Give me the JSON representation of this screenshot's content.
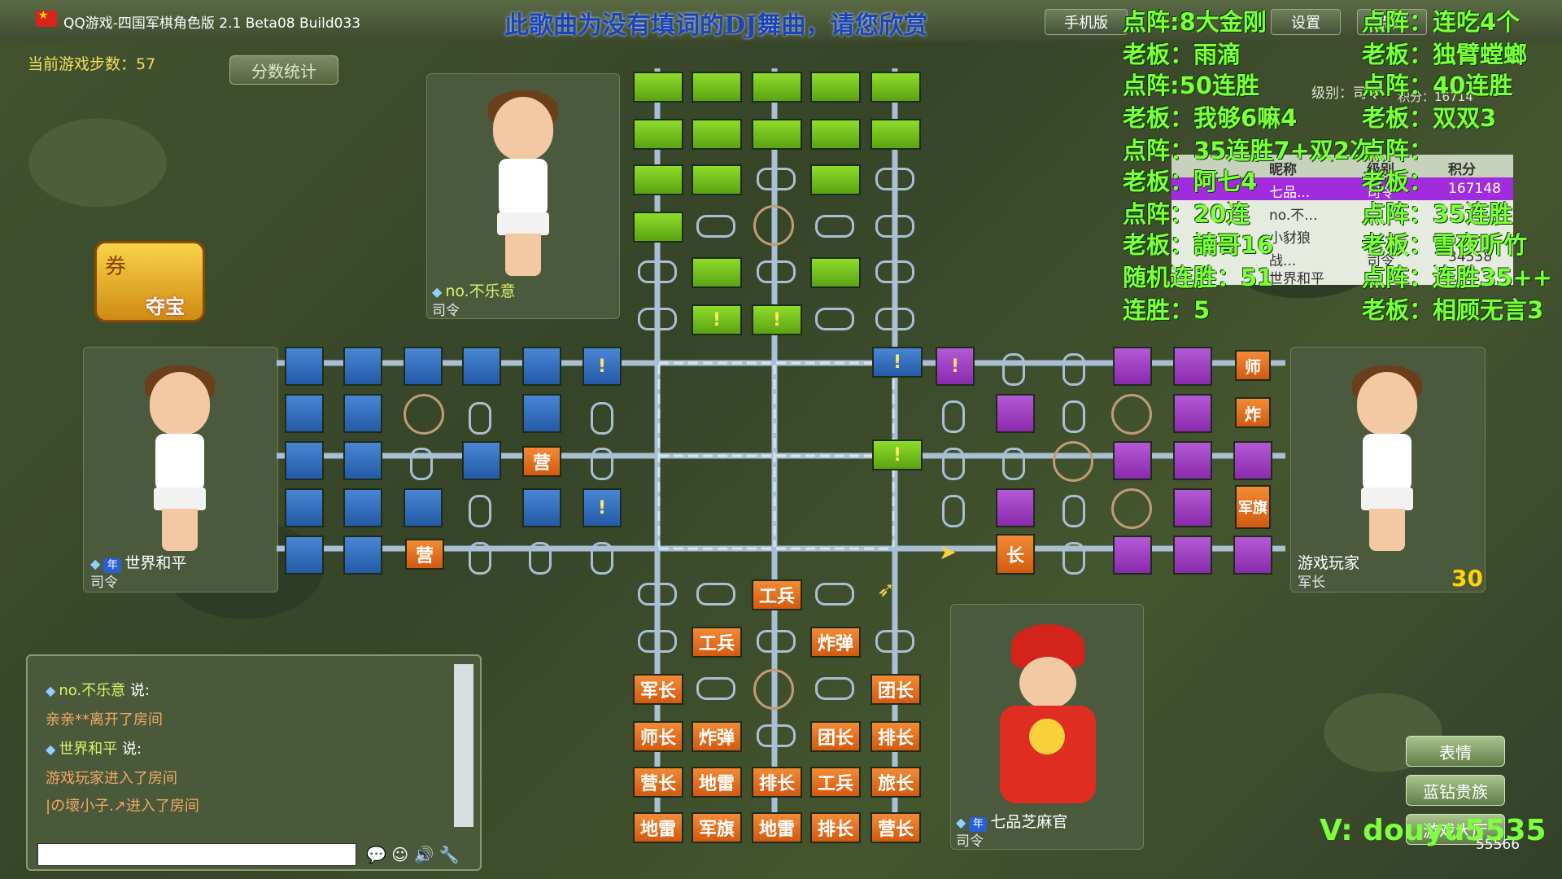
{
  "window": {
    "title": "QQ游戏-四国军棋角色版 2.1 Beta08 Build033",
    "banner": "此歌曲为没有填词的DJ舞曲，请您欣赏",
    "buttons": [
      "手机版",
      "设置",
      "点阵"
    ]
  },
  "status": {
    "steps_label": "当前游戏步数：57",
    "score_button": "分数统计",
    "treasure_label": "夺宝",
    "treasure_top": "券"
  },
  "players": {
    "top": {
      "name": "no.不乐意",
      "rank": "司令"
    },
    "left": {
      "name": "世界和平",
      "rank": "司令",
      "badge": "年"
    },
    "right": {
      "name": "游戏玩家",
      "rank": "军长",
      "score": "30"
    },
    "bottom": {
      "name": "七品芝麻官",
      "rank": "司令",
      "badge": "年"
    }
  },
  "board": {
    "top_marks": [
      "!",
      "!"
    ],
    "left_labels": [
      "营",
      "营",
      "!",
      "!"
    ],
    "center_marks": [
      "!",
      "!"
    ],
    "right_labels": [
      "师",
      "炸",
      "军旗",
      "!",
      "长"
    ],
    "bottom_rows": [
      [
        "",
        "",
        "工兵",
        "",
        ""
      ],
      [
        "",
        "工兵",
        "",
        "炸弹",
        ""
      ],
      [
        "军长",
        "",
        "",
        "",
        "团长"
      ],
      [
        "师长",
        "炸弹",
        "",
        "团长",
        "排长"
      ],
      [
        "营长",
        "地雷",
        "排长",
        "工兵",
        "旅长"
      ],
      [
        "地雷",
        "军旗",
        "地雷",
        "排长",
        "营长"
      ]
    ]
  },
  "chat": {
    "lines": [
      {
        "user": "no.不乐意",
        "said": "说:"
      },
      {
        "text": "亲亲**离开了房间"
      },
      {
        "user": "世界和平",
        "said": "说:"
      },
      {
        "text": "游戏玩家进入了房间"
      },
      {
        "text": "|の壞小子.↗进入了房间"
      }
    ]
  },
  "rank_table": {
    "headers": [
      "昵称",
      "级别",
      "积分"
    ],
    "rows": [
      {
        "name": "七品...",
        "level": "司令",
        "score": "167148"
      },
      {
        "name": "no.不...",
        "level": "",
        "score": ""
      },
      {
        "name": "小豺狼",
        "level": "",
        "score": ""
      },
      {
        "name": "战...",
        "level": "司令",
        "score": "34558"
      },
      {
        "name": "世界和平",
        "level": "",
        "score": ""
      }
    ],
    "profile": {
      "level": "级别：司令",
      "score": "积分：16714"
    }
  },
  "overlay_left": [
    "点阵:8大金刚",
    "老板：雨滴",
    "点阵:50连胜",
    "老板：我够6嘛4",
    "点阵：35连胜7+双2次",
    "老板：阿七4",
    "点阵：20连",
    "老板：諵哥16",
    "随机连胜：51",
    "连胜：5"
  ],
  "overlay_right": [
    "点阵：连吃4个",
    "老板：独臂螳螂",
    "点阵：40连胜",
    "老板：双双3",
    "点阵：",
    "老板：",
    "点阵：35连胜",
    "老板：雪夜听竹",
    "点阵：连胜35++",
    "老板：相顾无言3"
  ],
  "side_buttons": [
    "表情",
    "蓝钻贵族",
    "游戏大厅"
  ],
  "watermark": "V: douyu5535",
  "room_number": "55566",
  "colors": {
    "green": "#7dff3e",
    "blue": "#245aa6",
    "purple": "#8a2aad",
    "orange": "#d25a10"
  }
}
